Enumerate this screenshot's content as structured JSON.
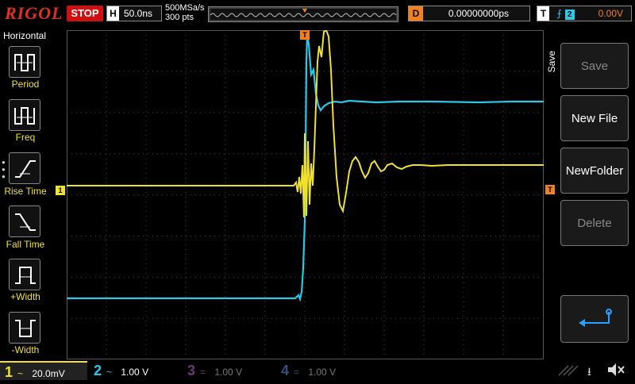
{
  "topbar": {
    "brand": "RIGOL",
    "run_state": "STOP",
    "timebase_key": "H",
    "timebase_value": "50.0ns",
    "sample_rate": "500MSa/s",
    "mem_depth": "300 pts",
    "delay_key": "D",
    "delay_value": "0.00000000ps",
    "trigger_key": "T",
    "trigger_source": "2",
    "trigger_level": "0.00V"
  },
  "left_menu": {
    "header": "Horizontal",
    "items": [
      {
        "label": "Period"
      },
      {
        "label": "Freq"
      },
      {
        "label": "Rise Time"
      },
      {
        "label": "Fall Time"
      },
      {
        "label": "+Width"
      },
      {
        "label": "-Width"
      }
    ]
  },
  "right_menu": {
    "header": "Save",
    "items": [
      {
        "label": "Save",
        "enabled": false
      },
      {
        "label": "New File",
        "enabled": true
      },
      {
        "label": "NewFolder",
        "enabled": true
      },
      {
        "label": "Delete",
        "enabled": false
      }
    ]
  },
  "markers": {
    "ch1": "1",
    "trigger": "T"
  },
  "channels": [
    {
      "num": "1",
      "coupling": "~",
      "scale": "20.0mV",
      "color": "#f0e030",
      "active": true
    },
    {
      "num": "2",
      "coupling": "~",
      "scale": "1.00 V",
      "color": "#29c8e8",
      "active": true
    },
    {
      "num": "3",
      "coupling": "=",
      "scale": "1.00 V",
      "color": "#d050d0",
      "active": false
    },
    {
      "num": "4",
      "coupling": "=",
      "scale": "1.00 V",
      "color": "#3080e0",
      "active": false
    }
  ],
  "status_icons": [
    "usb-icon",
    "speaker-muted-icon"
  ]
}
